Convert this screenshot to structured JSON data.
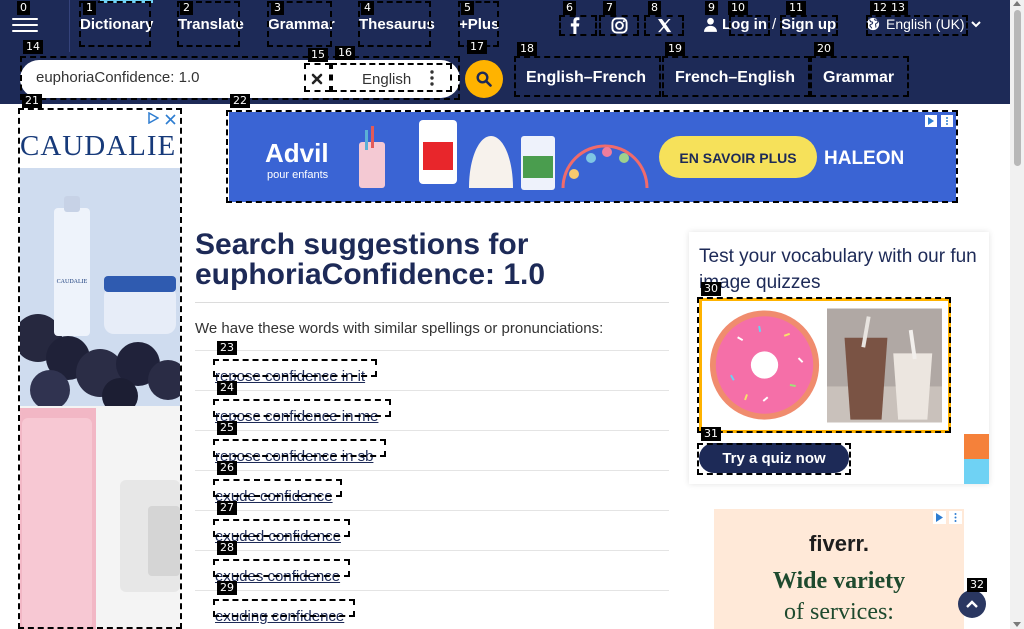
{
  "nav": {
    "links": [
      "Dictionary",
      "Translate",
      "Grammar",
      "Thesaurus",
      "+Plus"
    ],
    "login": "Log in",
    "separator": "/",
    "signup": "Sign up",
    "language": "English (UK)"
  },
  "search": {
    "value": "euphoriaConfidence: 1.0",
    "dictionary": "English",
    "quick_links": [
      "English–French",
      "French–English",
      "Grammar"
    ]
  },
  "ads": {
    "side_brand": "CAUDALIE",
    "side_product_label": "CAUDALIE",
    "banner_brand": "Advil",
    "banner_brand_sub": "pour enfants",
    "banner_cta": "EN SAVOIR PLUS",
    "banner_sponsor": "HALEON",
    "fiverr_brand": "fiverr.",
    "fiverr_line1": "Wide variety",
    "fiverr_line2": "of services:"
  },
  "main": {
    "title": "Search suggestions for",
    "term": "euphoriaConfidence: 1.0",
    "intro": "We have these words with similar spellings or pronunciations:",
    "suggestions": [
      "repose confidence in it",
      "repose confidence in me",
      "repose confidence in sb",
      "exude confidence",
      "exuded confidence",
      "exudes confidence",
      "exuding confidence"
    ]
  },
  "quiz": {
    "title": "Test your vocabulary with our fun image quizzes",
    "button": "Try a quiz now"
  },
  "marks": [
    "0",
    "1",
    "2",
    "3",
    "4",
    "5",
    "6",
    "7",
    "8",
    "9",
    "10",
    "11",
    "12",
    "13",
    "14",
    "15",
    "16",
    "17",
    "18",
    "19",
    "20",
    "21",
    "22",
    "23",
    "24",
    "25",
    "26",
    "27",
    "28",
    "29",
    "30",
    "31",
    "32"
  ],
  "colors": {
    "navy": "#1d2a57",
    "accent": "#ffb300",
    "active_tab": "#6fd2f4"
  }
}
